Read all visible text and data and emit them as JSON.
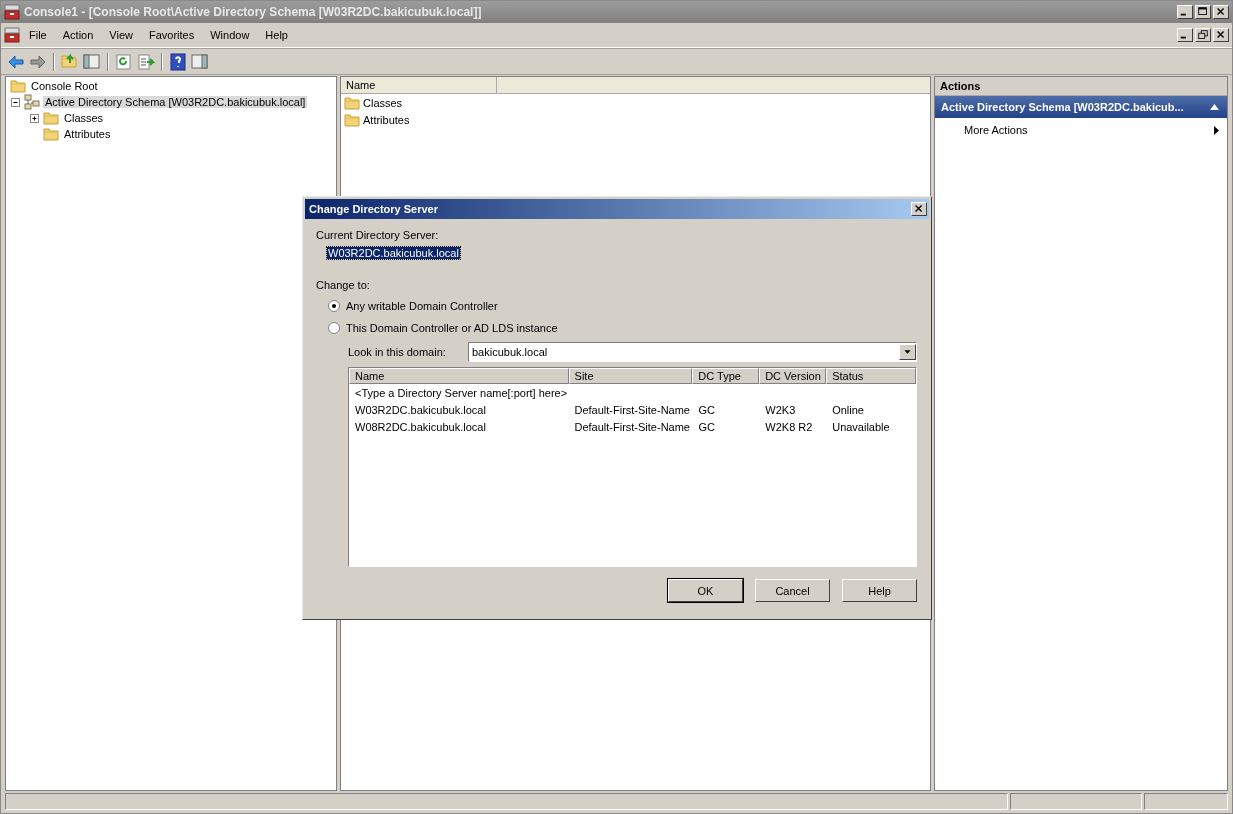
{
  "window": {
    "title": "Console1 - [Console Root\\Active Directory Schema [W03R2DC.bakicubuk.local]]"
  },
  "menu": [
    "File",
    "Action",
    "View",
    "Favorites",
    "Window",
    "Help"
  ],
  "tree": [
    {
      "label": "Console Root",
      "selected": false,
      "children": [
        {
          "label": "Active Directory Schema [W03R2DC.bakicubuk.local]",
          "expanded": true,
          "selected": true,
          "children": [
            {
              "label": "Classes",
              "expanded": false,
              "selected": false
            },
            {
              "label": "Attributes",
              "selected": false
            }
          ]
        }
      ]
    }
  ],
  "list": {
    "columns": [
      "Name"
    ],
    "items": [
      "Classes",
      "Attributes"
    ]
  },
  "actions": {
    "title": "Actions",
    "section": "Active Directory Schema [W03R2DC.bakicub...",
    "items": [
      "More Actions"
    ]
  },
  "dialog": {
    "title": "Change Directory Server",
    "current_label": "Current Directory Server:",
    "current_value": "W03R2DC.bakicubuk.local",
    "change_label": "Change to:",
    "options": [
      {
        "label": "Any writable Domain Controller",
        "selected": true
      },
      {
        "label": "This Domain Controller or AD LDS instance",
        "selected": false
      }
    ],
    "domain_label": "Look in this domain:",
    "domain_value": "bakicubuk.local",
    "table": {
      "columns": [
        "Name",
        "Site",
        "DC Type",
        "DC Version",
        "Status"
      ],
      "rows": [
        [
          "<Type a Directory Server name[:port] here>"
        ],
        [
          "W03R2DC.bakicubuk.local",
          "Default-First-Site-Name",
          "GC",
          "W2K3",
          "Online"
        ],
        [
          "W08R2DC.bakicubuk.local",
          "Default-First-Site-Name",
          "GC",
          "W2K8 R2",
          "Unavailable"
        ]
      ]
    },
    "buttons": [
      "OK",
      "Cancel",
      "Help"
    ]
  }
}
